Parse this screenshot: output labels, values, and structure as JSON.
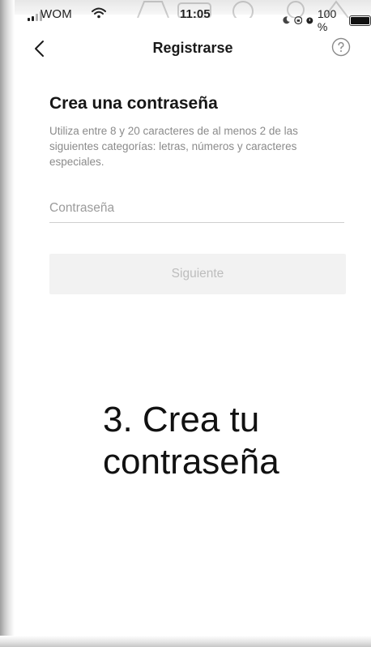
{
  "status_bar": {
    "carrier": "WOM",
    "time": "11:05",
    "battery": "100 %",
    "battery_level": 1.0
  },
  "nav": {
    "title": "Registrarse"
  },
  "form": {
    "heading": "Crea una contraseña",
    "description": "Utiliza entre 8 y 20 caracteres de al menos 2 de las siguientes categorías: letras, números y caracteres especiales.",
    "password_placeholder": "Contraseña",
    "password_value": "",
    "next_label": "Siguiente"
  },
  "caption": {
    "line1": "3. Crea tu",
    "line2": "contraseña"
  },
  "icons": {
    "back": "chevron-left-icon",
    "help": "help-circle-icon",
    "wifi": "wifi-icon",
    "signal": "signal-icon",
    "moon": "moon-icon",
    "lock_rotation": "rotation-lock-icon",
    "alarm": "alarm-icon",
    "battery": "battery-icon"
  },
  "colors": {
    "disabled_button_bg": "#f2f2f2",
    "disabled_button_text": "#bdbdbd",
    "description_text": "#8b8b8b"
  }
}
